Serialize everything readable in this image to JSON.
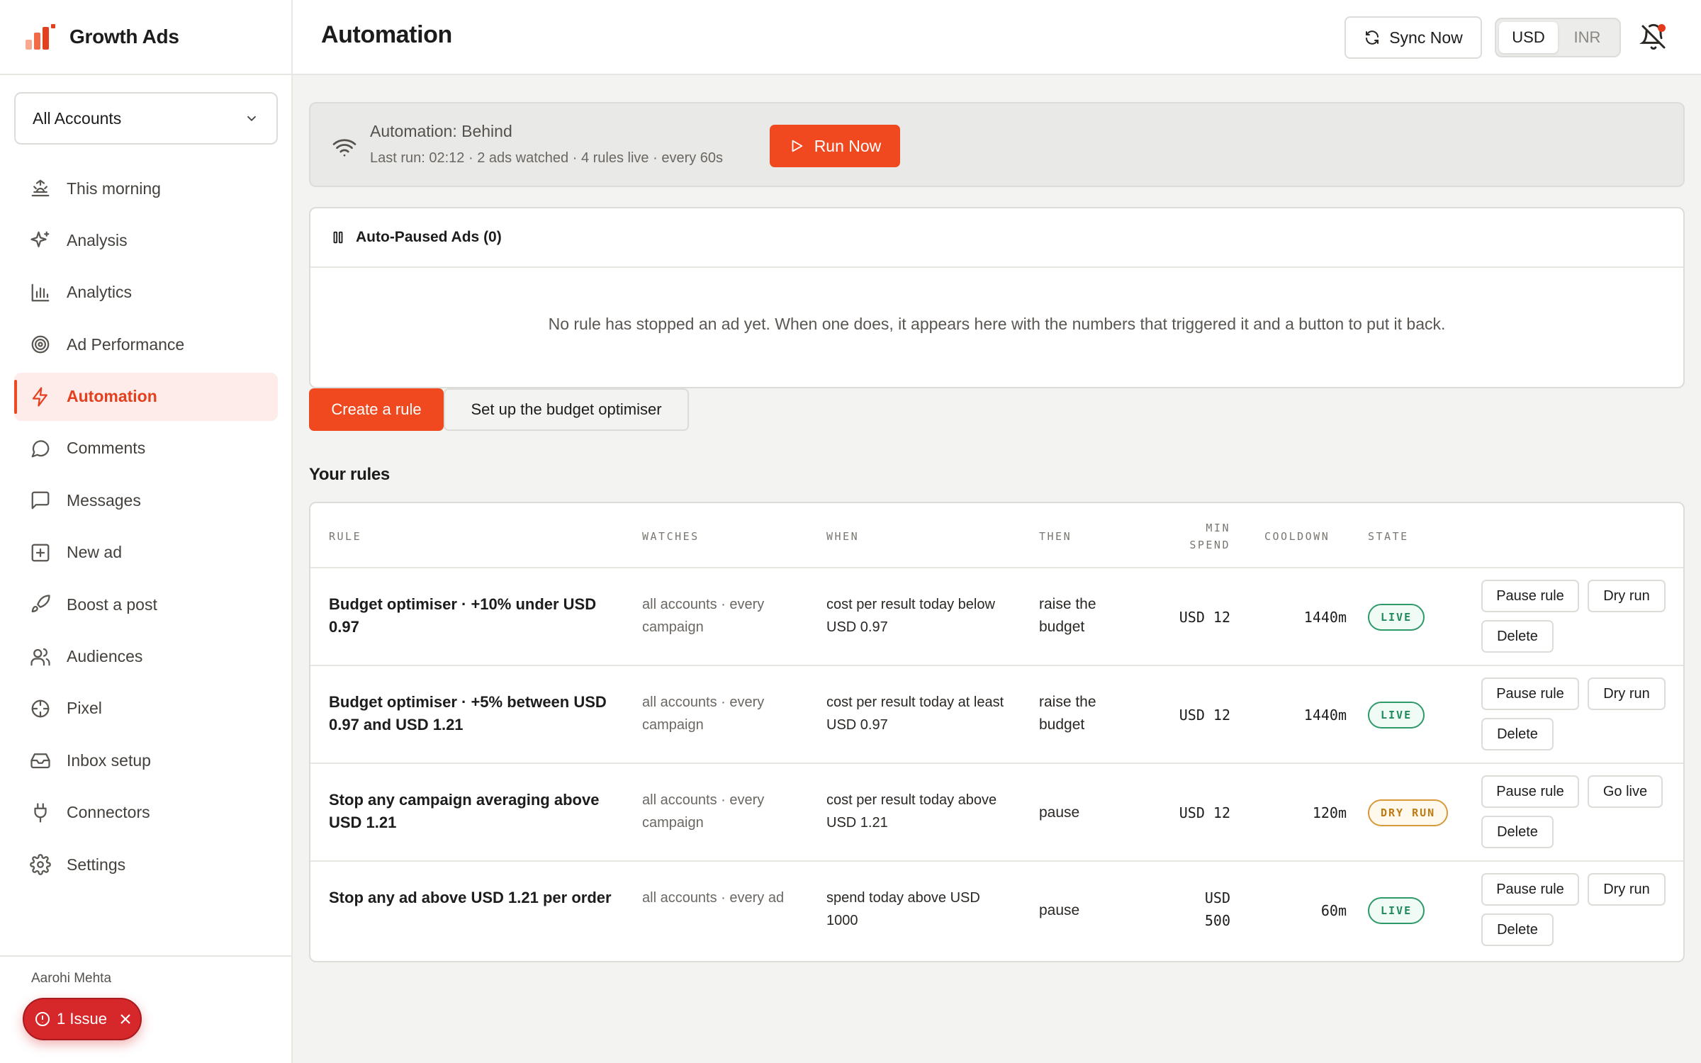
{
  "brand": {
    "name": "Growth Ads"
  },
  "account_select": {
    "value": "All Accounts"
  },
  "nav": [
    {
      "label": "This morning",
      "icon": "sunrise-icon",
      "active": false
    },
    {
      "label": "Analysis",
      "icon": "sparkles-icon",
      "active": false
    },
    {
      "label": "Analytics",
      "icon": "bar-chart-icon",
      "active": false
    },
    {
      "label": "Ad Performance",
      "icon": "target-icon",
      "active": false
    },
    {
      "label": "Automation",
      "icon": "bolt-icon",
      "active": true
    },
    {
      "label": "Comments",
      "icon": "chat-bubble-icon",
      "active": false
    },
    {
      "label": "Messages",
      "icon": "message-square-icon",
      "active": false
    },
    {
      "label": "New ad",
      "icon": "plus-square-icon",
      "active": false
    },
    {
      "label": "Boost a post",
      "icon": "rocket-icon",
      "active": false
    },
    {
      "label": "Audiences",
      "icon": "users-icon",
      "active": false
    },
    {
      "label": "Pixel",
      "icon": "crosshair-icon",
      "active": false
    },
    {
      "label": "Inbox setup",
      "icon": "inbox-icon",
      "active": false
    },
    {
      "label": "Connectors",
      "icon": "plug-icon",
      "active": false
    },
    {
      "label": "Settings",
      "icon": "gear-icon",
      "active": false
    }
  ],
  "footer": {
    "user_name": "Aarohi Mehta",
    "issue_label": "1 Issue"
  },
  "header": {
    "title": "Automation",
    "sync_label": "Sync Now",
    "currencies": [
      "USD",
      "INR"
    ],
    "selected_currency": "USD"
  },
  "status": {
    "title": "Automation: Behind",
    "subtitle": "Last run: 02:12 · 2 ads watched · 4 rules live · every 60s",
    "run_label": "Run Now"
  },
  "paused": {
    "title": "Auto-Paused Ads (0)",
    "empty_text": "No rule has stopped an ad yet. When one does, it appears here with the numbers that triggered it and a button to put it back."
  },
  "actions": {
    "create_label": "Create a rule",
    "budget_label": "Set up the budget optimiser"
  },
  "rules_section": {
    "title": "Your rules",
    "columns": {
      "rule": "RULE",
      "watches": "WATCHES",
      "when": "WHEN",
      "then": "THEN",
      "min_spend_1": "MIN",
      "min_spend_2": "SPEND",
      "cooldown": "COOLDOWN",
      "state": "STATE"
    },
    "rows": [
      {
        "rule": "Budget optimiser · +10% under USD 0.97",
        "watches": "all accounts · every campaign",
        "when": "cost per result today below USD 0.97",
        "then": "raise the budget",
        "min_spend": "USD 12",
        "cooldown": "1440m",
        "state": "LIVE",
        "state_kind": "live",
        "action1": "Pause rule",
        "action2": "Dry run",
        "action3": "Delete"
      },
      {
        "rule": "Budget optimiser · +5% between USD 0.97 and USD 1.21",
        "watches": "all accounts · every campaign",
        "when": "cost per result today at least USD 0.97",
        "then": "raise the budget",
        "min_spend": "USD 12",
        "cooldown": "1440m",
        "state": "LIVE",
        "state_kind": "live",
        "action1": "Pause rule",
        "action2": "Dry run",
        "action3": "Delete"
      },
      {
        "rule": "Stop any campaign averaging above USD 1.21",
        "watches": "all accounts · every campaign",
        "when": "cost per result today above USD 1.21",
        "then": "pause",
        "min_spend": "USD 12",
        "cooldown": "120m",
        "state": "DRY RUN",
        "state_kind": "dry",
        "action1": "Pause rule",
        "action2": "Go live",
        "action3": "Delete"
      },
      {
        "rule": "Stop any ad above USD 1.21 per order",
        "watches": "all accounts · every ad",
        "when": "spend today above USD 1000",
        "then": "pause",
        "min_spend": "USD 500",
        "cooldown": "60m",
        "state": "LIVE",
        "state_kind": "live",
        "action1": "Pause rule",
        "action2": "Dry run",
        "action3": "Delete"
      }
    ]
  },
  "colors": {
    "accent": "#f0491f",
    "live": "#2e9a6a",
    "dry_run": "#d69a3a",
    "issue": "#d6272b"
  }
}
